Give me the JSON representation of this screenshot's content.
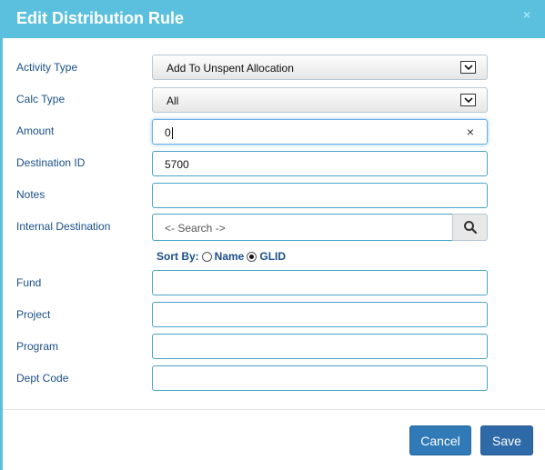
{
  "dialog": {
    "title": "Edit Distribution Rule",
    "close_glyph": "×"
  },
  "form": {
    "activity_type": {
      "label": "Activity Type",
      "value": "Add To Unspent Allocation"
    },
    "calc_type": {
      "label": "Calc Type",
      "value": "All"
    },
    "amount": {
      "label": "Amount",
      "value": "0",
      "clear_glyph": "×"
    },
    "destination_id": {
      "label": "Destination ID",
      "value": "5700"
    },
    "notes": {
      "label": "Notes",
      "value": ""
    },
    "internal_destination": {
      "label": "Internal Destination",
      "placeholder": "<- Search ->"
    },
    "sort_by": {
      "label": "Sort By:",
      "options": [
        "Name",
        "GLID"
      ],
      "selected": "GLID"
    },
    "fund": {
      "label": "Fund",
      "value": ""
    },
    "project": {
      "label": "Project",
      "value": ""
    },
    "program": {
      "label": "Program",
      "value": ""
    },
    "dept_code": {
      "label": "Dept Code",
      "value": ""
    }
  },
  "footer": {
    "cancel_label": "Cancel",
    "save_label": "Save"
  },
  "icons": {
    "dropdown": "chevron-down-icon",
    "search": "search-icon",
    "close": "close-icon"
  },
  "colors": {
    "header": "#5bc0de",
    "label_text": "#1a4f8a",
    "primary_button": "#2f7ab7"
  }
}
